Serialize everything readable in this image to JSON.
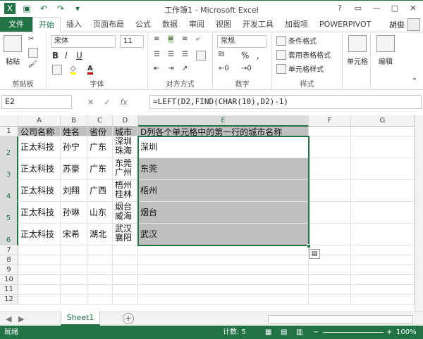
{
  "window": {
    "title": "工作簿1 - Microsoft Excel"
  },
  "qat": [
    "save-icon",
    "undo-icon",
    "redo-icon",
    "customize-icon"
  ],
  "win_controls": {
    "help": "?",
    "restore": "▭",
    "minimize": "—",
    "maximize": "□",
    "close": "✕"
  },
  "tabs": [
    "文件",
    "开始",
    "插入",
    "页面布局",
    "公式",
    "数据",
    "审阅",
    "视图",
    "开发工具",
    "加载项",
    "POWERPIVOT"
  ],
  "user": "胡俊",
  "ribbon": {
    "clipboard": {
      "label": "剪贴板",
      "paste": "粘贴"
    },
    "font": {
      "label": "字体",
      "name": "宋体",
      "size": "11",
      "bold": "B",
      "italic": "I",
      "underline": "U"
    },
    "align": {
      "label": "对齐方式"
    },
    "number": {
      "label": "数字",
      "format": "常规",
      "percent": "%",
      "comma": ","
    },
    "styles": {
      "label": "样式",
      "cond": "条件格式",
      "table": "套用表格格式",
      "cell": "单元格样式"
    },
    "cells": {
      "label": "单元格"
    },
    "edit": {
      "label": "编辑"
    }
  },
  "formula_bar": {
    "namebox": "E2",
    "fx": "fx",
    "formula": "=LEFT(D2,FIND(CHAR(10),D2)-1)"
  },
  "columns": [
    "A",
    "B",
    "C",
    "D",
    "E",
    "F",
    "G"
  ],
  "rows": [
    "1",
    "2",
    "3",
    "4",
    "5",
    "6",
    "7",
    "8",
    "9",
    "10",
    "11",
    "12"
  ],
  "header_row": [
    "公司名称",
    "姓名",
    "省份",
    "城市",
    "D列各个单元格中的第一行的城市名称"
  ],
  "data_rows": [
    {
      "a": "正太科技",
      "b": "孙宁",
      "c": "广东",
      "d1": "深圳",
      "d2": "珠海",
      "e": "深圳"
    },
    {
      "a": "正太科技",
      "b": "苏豪",
      "c": "广东",
      "d1": "东莞",
      "d2": "广州",
      "e": "东莞"
    },
    {
      "a": "正太科技",
      "b": "刘翔",
      "c": "广西",
      "d1": "梧州",
      "d2": "桂林",
      "e": "梧州"
    },
    {
      "a": "正太科技",
      "b": "孙琳",
      "c": "山东",
      "d1": "烟台",
      "d2": "威海",
      "e": "烟台"
    },
    {
      "a": "正太科技",
      "b": "宋希",
      "c": "湖北",
      "d1": "武汉",
      "d2": "襄阳",
      "e": "武汉"
    }
  ],
  "sheet": {
    "name": "Sheet1",
    "add": "+"
  },
  "status": {
    "ready": "就绪",
    "count": "计数: 5",
    "zoom": "100%",
    "zoom_minus": "−",
    "zoom_plus": "+"
  }
}
